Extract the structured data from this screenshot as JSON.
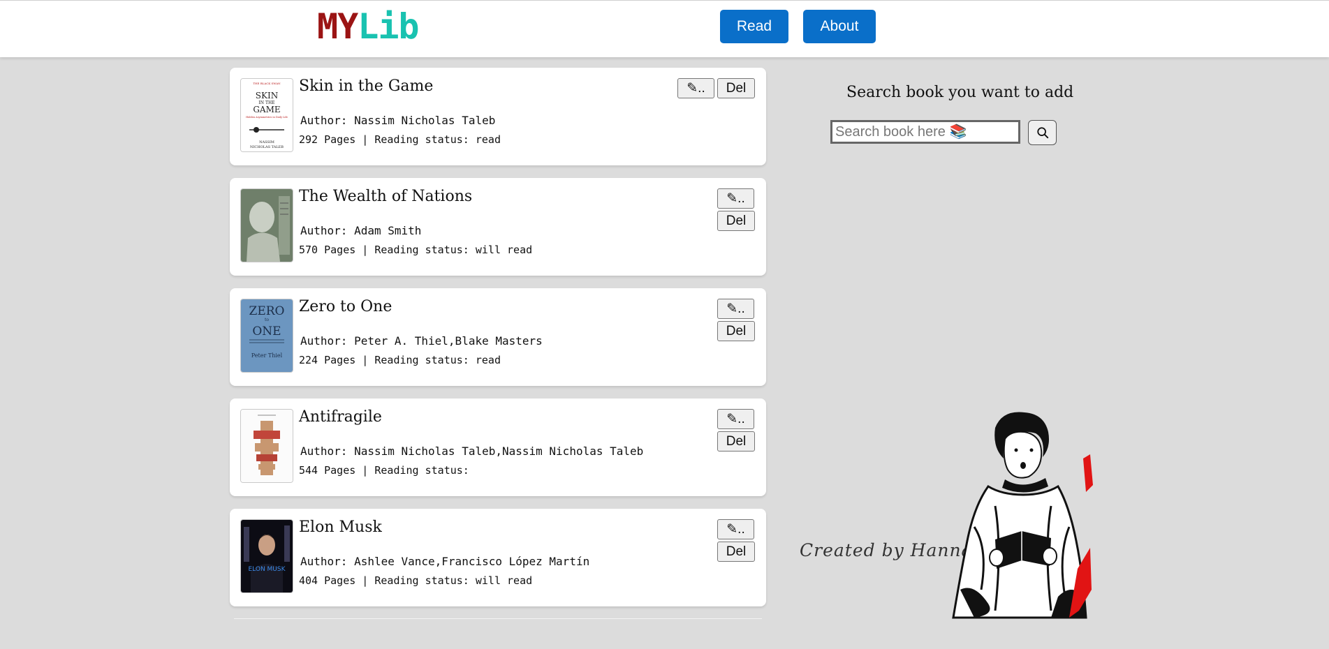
{
  "header": {
    "logo_part1": "MY",
    "logo_part2": "Lib",
    "nav": {
      "read": "Read",
      "about": "About"
    }
  },
  "books": [
    {
      "title": "Skin in the Game",
      "author": "Author: Nassim Nicholas Taleb",
      "meta": "292 Pages | Reading status: read",
      "edit_label": "✎..",
      "del_label": "Del"
    },
    {
      "title": "The Wealth of Nations",
      "author": "Author: Adam Smith",
      "meta": "570 Pages | Reading status: will read",
      "edit_label": "✎..",
      "del_label": "Del"
    },
    {
      "title": "Zero to One",
      "author": "Author: Peter A. Thiel,Blake Masters",
      "meta": "224 Pages | Reading status: read",
      "edit_label": "✎..",
      "del_label": "Del"
    },
    {
      "title": "Antifragile",
      "author": "Author: Nassim Nicholas Taleb,Nassim Nicholas Taleb",
      "meta": "544 Pages | Reading status:",
      "edit_label": "✎..",
      "del_label": "Del"
    },
    {
      "title": "Elon Musk",
      "author": "Author: Ashlee Vance,Francisco López Martín",
      "meta": "404 Pages | Reading status: will read",
      "edit_label": "✎..",
      "del_label": "Del"
    }
  ],
  "covers": {
    "skin": {
      "top": "THE BLACK SWAN",
      "line1": "SKIN",
      "line2": "IN THE",
      "line3": "GAME",
      "sub": "Hidden Asymmetries in Daily Life",
      "author1": "NASSIM",
      "author2": "NICHOLAS TALEB"
    },
    "zero": {
      "line1": "ZERO",
      "line2": "to",
      "line3": "ONE",
      "author": "Peter Thiel"
    },
    "elon": {
      "title": "ELON MUSK"
    }
  },
  "search": {
    "heading": "Search book you want to add",
    "placeholder": "Search book here 📚",
    "button_icon": "search-icon"
  },
  "footer": {
    "credit": "Created by Hanna"
  },
  "colors": {
    "logo_my": "#9b1414",
    "logo_lib": "#19c2b0",
    "nav_button": "#0a6fc9",
    "background": "#dcdcdc"
  }
}
